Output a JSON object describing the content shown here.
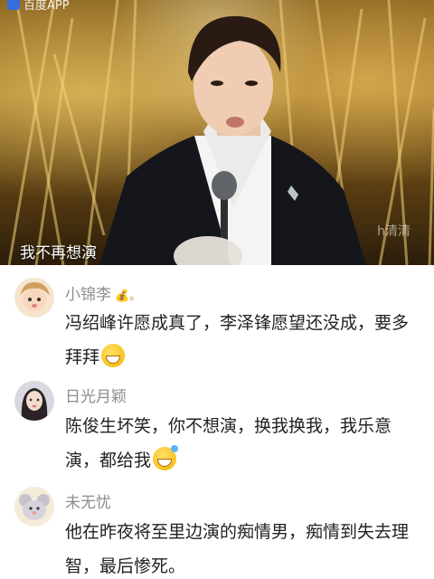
{
  "video": {
    "watermark": "百度APP",
    "channel_tag": "h清清",
    "caption": "我不再想演"
  },
  "comments": [
    {
      "name": "小锦李",
      "badge": "💰。",
      "text": "冯绍峰许愿成真了，李泽锋愿望还没成，要多拜拜",
      "emoji": "grin-icon"
    },
    {
      "name": "日光月颖",
      "badge": "",
      "text": "陈俊生坏笑，你不想演，换我换我，我乐意演，都给我",
      "emoji": "laugh-cry-icon"
    },
    {
      "name": "未无忧",
      "badge": "",
      "text": "他在昨夜将至里边演的痴情男，痴情到失去理智，最后惨死。",
      "emoji": ""
    }
  ]
}
